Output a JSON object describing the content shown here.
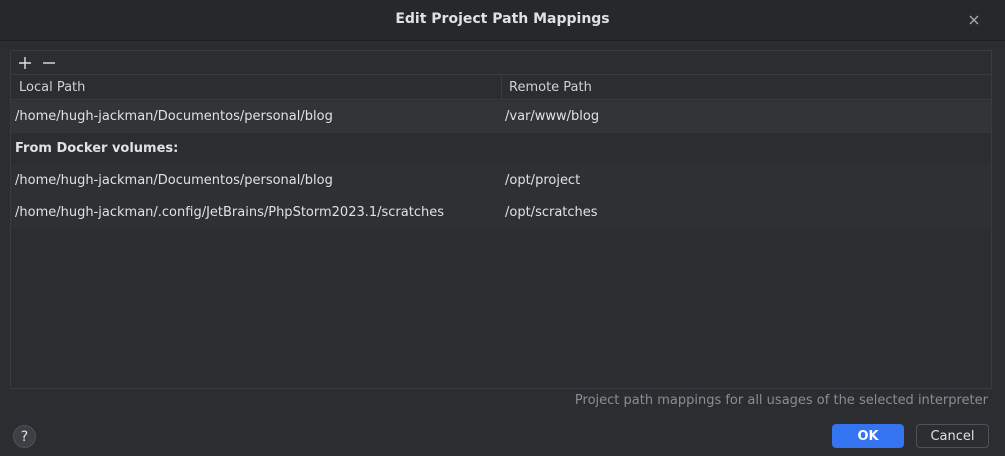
{
  "dialog": {
    "title": "Edit Project Path Mappings",
    "close_icon": "close-icon"
  },
  "toolbar": {
    "add_icon": "plus-icon",
    "remove_icon": "minus-icon"
  },
  "table": {
    "columns": [
      "Local Path",
      "Remote Path"
    ],
    "rows": [
      {
        "local": "/home/hugh-jackman/Documentos/personal/blog",
        "remote": "/var/www/blog"
      }
    ],
    "group_label": "From Docker volumes:",
    "docker_rows": [
      {
        "local": "/home/hugh-jackman/Documentos/personal/blog",
        "remote": "/opt/project"
      },
      {
        "local": "/home/hugh-jackman/.config/JetBrains/PhpStorm2023.1/scratches",
        "remote": "/opt/scratches"
      }
    ]
  },
  "hint": "Project path mappings for all usages of the selected interpreter",
  "footer": {
    "help_label": "?",
    "ok_label": "OK",
    "cancel_label": "Cancel"
  },
  "colors": {
    "accent": "#3574f0",
    "background": "#2b2d30"
  }
}
